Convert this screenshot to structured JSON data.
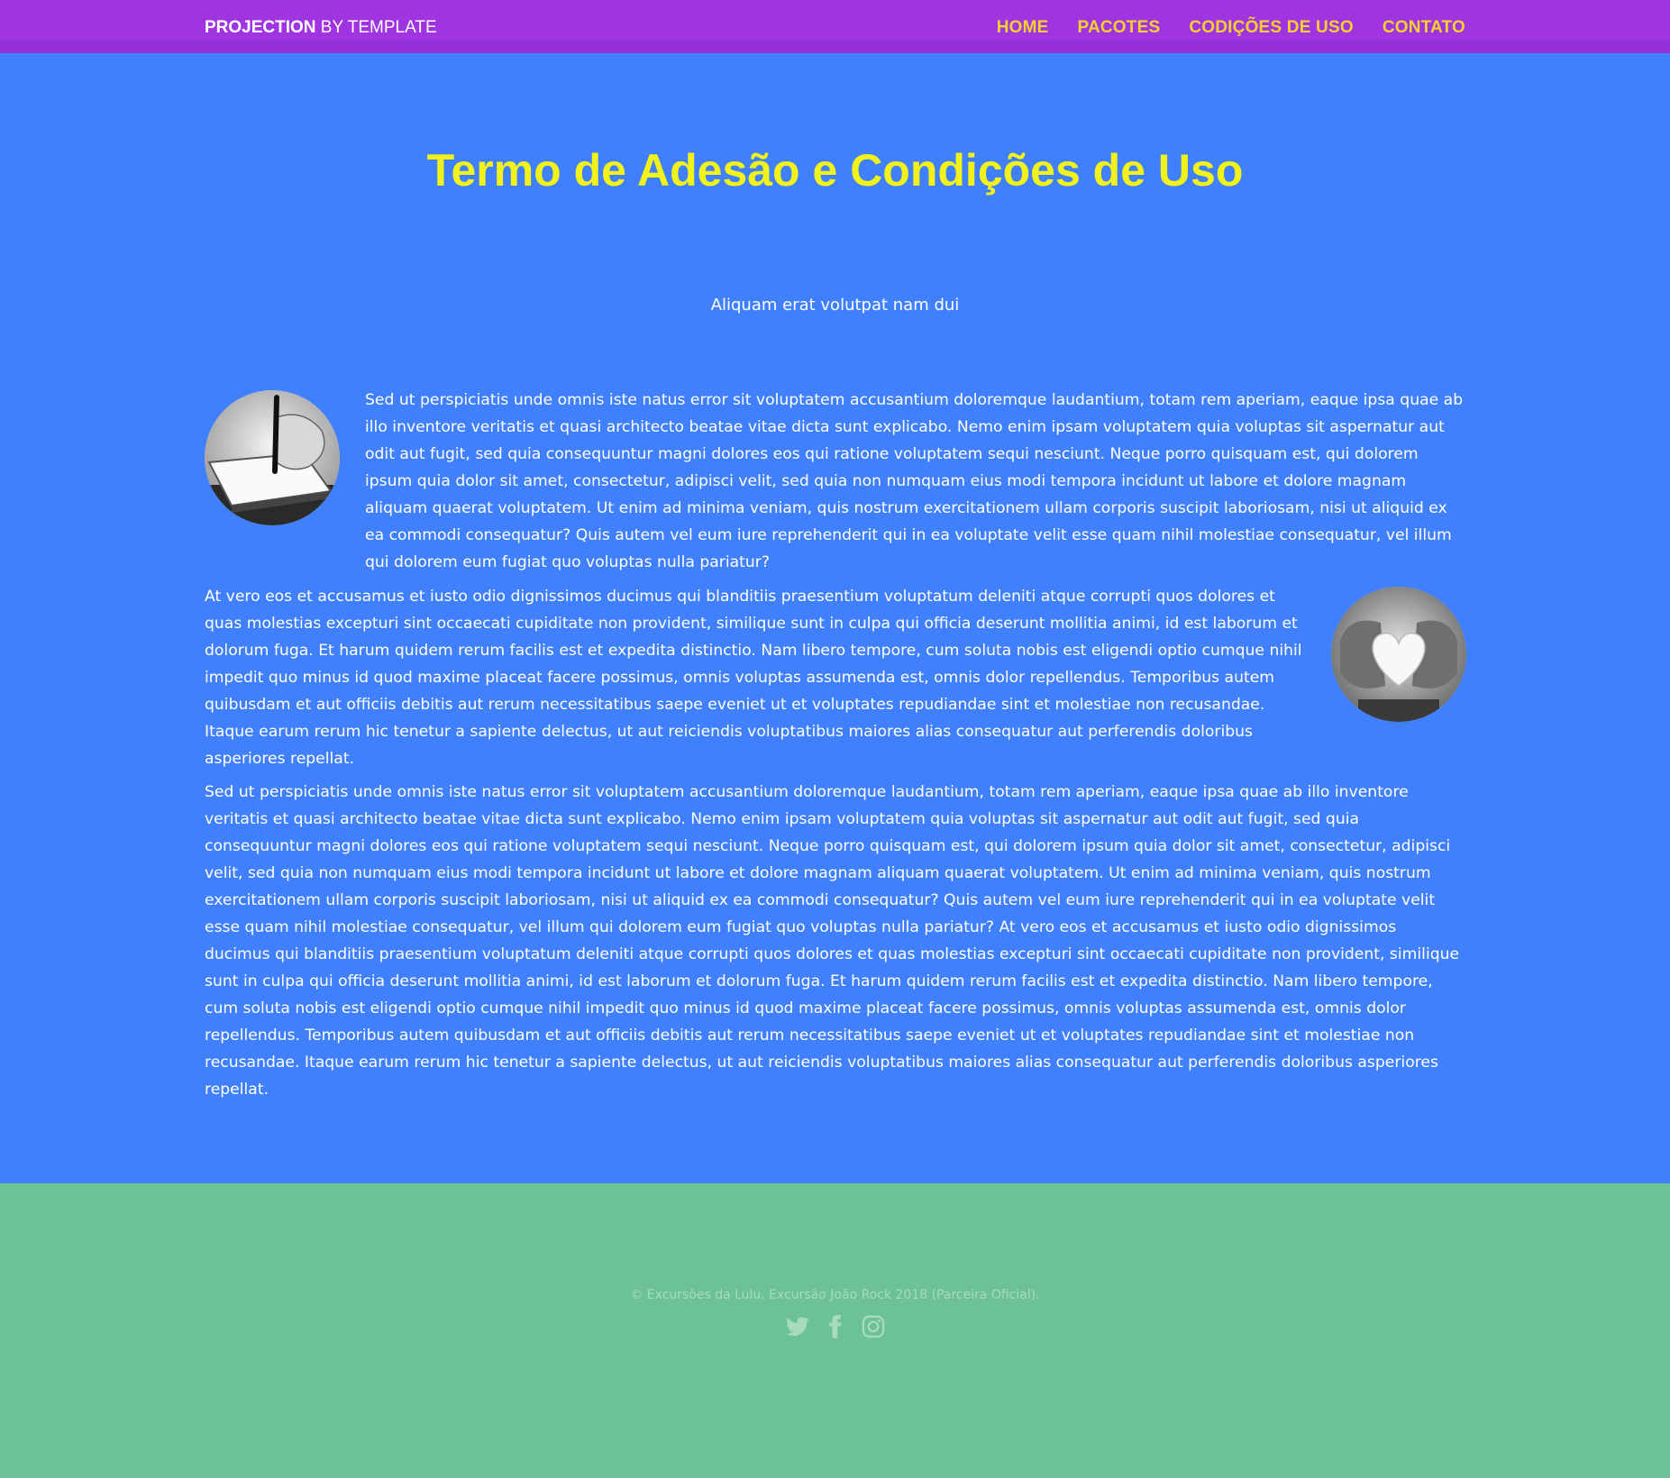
{
  "header": {
    "logo_strong": "PROJECTION",
    "logo_rest": " BY TEMPLATE",
    "nav": [
      {
        "label": "HOME"
      },
      {
        "label": "PACOTES"
      },
      {
        "label": "CODIÇÕES DE USO"
      },
      {
        "label": "CONTATO"
      }
    ]
  },
  "main": {
    "title": "Termo de Adesão e Condições de Uso",
    "subtitle": "Aliquam erat volutpat nam dui",
    "paragraphs": [
      "Sed ut perspiciatis unde omnis iste natus error sit voluptatem accusantium doloremque laudantium, totam rem aperiam, eaque ipsa quae ab illo inventore veritatis et quasi architecto beatae vitae dicta sunt explicabo. Nemo enim ipsam voluptatem quia voluptas sit aspernatur aut odit aut fugit, sed quia consequuntur magni dolores eos qui ratione voluptatem sequi nesciunt. Neque porro quisquam est, qui dolorem ipsum quia dolor sit amet, consectetur, adipisci velit, sed quia non numquam eius modi tempora incidunt ut labore et dolore magnam aliquam quaerat voluptatem. Ut enim ad minima veniam, quis nostrum exercitationem ullam corporis suscipit laboriosam, nisi ut aliquid ex ea commodi consequatur? Quis autem vel eum iure reprehenderit qui in ea voluptate velit esse quam nihil molestiae consequatur, vel illum qui dolorem eum fugiat quo voluptas nulla pariatur?",
      "At vero eos et accusamus et iusto odio dignissimos ducimus qui blanditiis praesentium voluptatum deleniti atque corrupti quos dolores et quas molestias excepturi sint occaecati cupiditate non provident, similique sunt in culpa qui officia deserunt mollitia animi, id est laborum et dolorum fuga. Et harum quidem rerum facilis est et expedita distinctio. Nam libero tempore, cum soluta nobis est eligendi optio cumque nihil impedit quo minus id quod maxime placeat facere possimus, omnis voluptas assumenda est, omnis dolor repellendus. Temporibus autem quibusdam et aut officiis debitis aut rerum necessitatibus saepe eveniet ut et voluptates repudiandae sint et molestiae non recusandae. Itaque earum rerum hic tenetur a sapiente delectus, ut aut reiciendis voluptatibus maiores alias consequatur aut perferendis doloribus asperiores repellat.",
      "Sed ut perspiciatis unde omnis iste natus error sit voluptatem accusantium doloremque laudantium, totam rem aperiam, eaque ipsa quae ab illo inventore veritatis et quasi architecto beatae vitae dicta sunt explicabo. Nemo enim ipsam voluptatem quia voluptas sit aspernatur aut odit aut fugit, sed quia consequuntur magni dolores eos qui ratione voluptatem sequi nesciunt. Neque porro quisquam est, qui dolorem ipsum quia dolor sit amet, consectetur, adipisci velit, sed quia non numquam eius modi tempora incidunt ut labore et dolore magnam aliquam quaerat voluptatem. Ut enim ad minima veniam, quis nostrum exercitationem ullam corporis suscipit laboriosam, nisi ut aliquid ex ea commodi consequatur? Quis autem vel eum iure reprehenderit qui in ea voluptate velit esse quam nihil molestiae consequatur, vel illum qui dolorem eum fugiat quo voluptas nulla pariatur? At vero eos et accusamus et iusto odio dignissimos ducimus qui blanditiis praesentium voluptatum deleniti atque corrupti quos dolores et quas molestias excepturi sint occaecati cupiditate non provident, similique sunt in culpa qui officia deserunt mollitia animi, id est laborum et dolorum fuga. Et harum quidem rerum facilis est et expedita distinctio. Nam libero tempore, cum soluta nobis est eligendi optio cumque nihil impedit quo minus id quod maxime placeat facere possimus, omnis voluptas assumenda est, omnis dolor repellendus. Temporibus autem quibusdam et aut officiis debitis aut rerum necessitatibus saepe eveniet ut et voluptates repudiandae sint et molestiae non recusandae. Itaque earum rerum hic tenetur a sapiente delectus, ut aut reiciendis voluptatibus maiores alias consequatur aut perferendis doloribus asperiores repellat."
    ]
  },
  "footer": {
    "copyright": "© Excursões da Lulu. Excursão João Rock 2018 (Parceira Oficial).",
    "social_icons": [
      "twitter-icon",
      "facebook-icon",
      "instagram-icon"
    ]
  },
  "colors": {
    "header_bg": "#a034e0",
    "nav_link": "#f3d12f",
    "page_bg": "#4080fd",
    "title": "#f2f21b",
    "footer_bg": "#6dc295",
    "footer_text": "#a7dbbc"
  }
}
